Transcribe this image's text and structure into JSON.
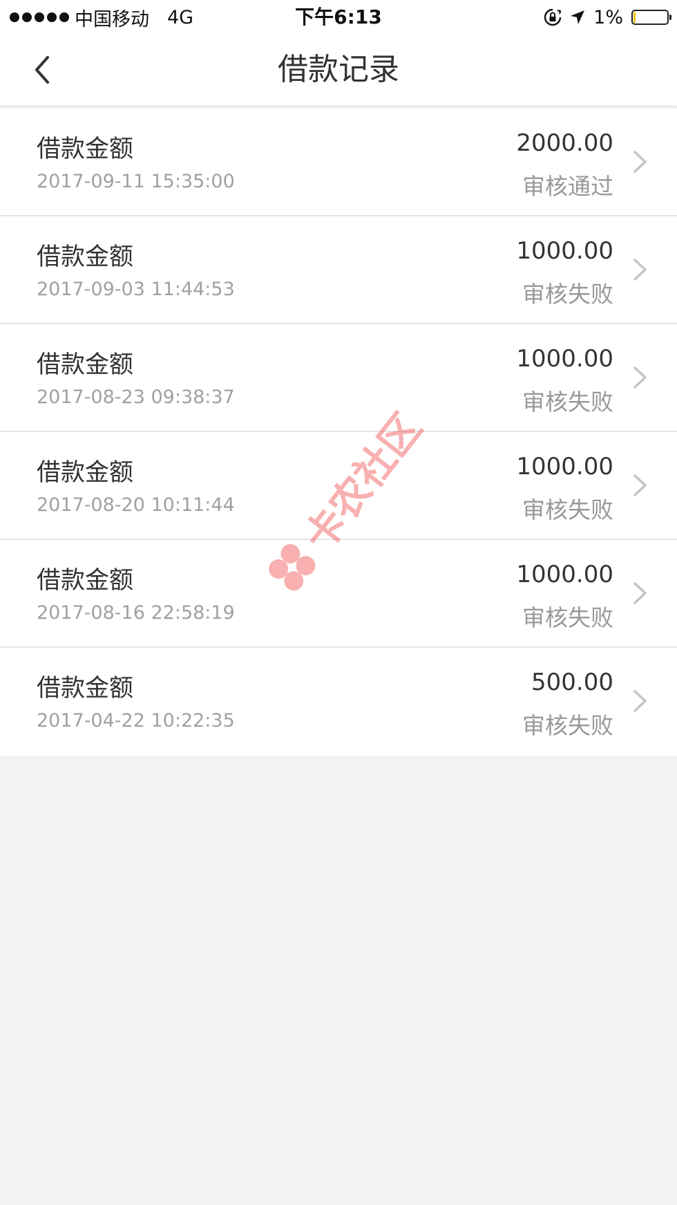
{
  "status_bar": {
    "carrier": "中国移动",
    "network": "4G",
    "time": "下午6:13",
    "battery_percent": "1%",
    "battery_level": 0.01,
    "battery_fill_color": "#f2c600"
  },
  "nav": {
    "title": "借款记录",
    "back_icon": "chevron-left-icon"
  },
  "records": [
    {
      "label": "借款金额",
      "time": "2017-09-11 15:35:00",
      "amount": "2000.00",
      "status": "审核通过"
    },
    {
      "label": "借款金额",
      "time": "2017-09-03 11:44:53",
      "amount": "1000.00",
      "status": "审核失败"
    },
    {
      "label": "借款金额",
      "time": "2017-08-23 09:38:37",
      "amount": "1000.00",
      "status": "审核失败"
    },
    {
      "label": "借款金额",
      "time": "2017-08-20 10:11:44",
      "amount": "1000.00",
      "status": "审核失败"
    },
    {
      "label": "借款金额",
      "time": "2017-08-16 22:58:19",
      "amount": "1000.00",
      "status": "审核失败"
    },
    {
      "label": "借款金额",
      "time": "2017-04-22 10:22:35",
      "amount": "500.00",
      "status": "审核失败"
    }
  ],
  "watermark": {
    "text": "卡农社区"
  },
  "colors": {
    "background": "#f2f2f2",
    "card": "#ffffff",
    "primary_text": "#333333",
    "secondary_text": "#a0a0a0",
    "watermark": "#f05050"
  }
}
